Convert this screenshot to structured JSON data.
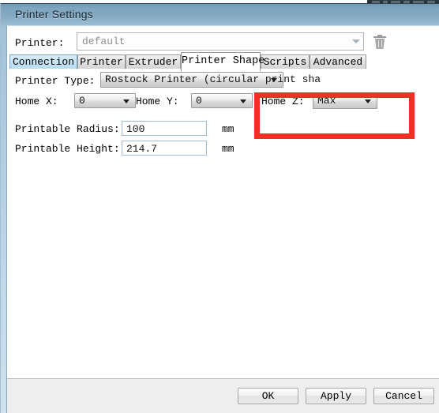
{
  "window": {
    "title": "Printer Settings"
  },
  "printer_row": {
    "label": "Printer:",
    "value": "default",
    "delete_icon": "trash-icon"
  },
  "tabs": [
    {
      "label": "Connection",
      "state": "hover"
    },
    {
      "label": "Printer",
      "state": "normal"
    },
    {
      "label": "Extruder",
      "state": "normal"
    },
    {
      "label": "Printer Shape",
      "state": "active"
    },
    {
      "label": "Scripts",
      "state": "normal"
    },
    {
      "label": "Advanced",
      "state": "normal"
    }
  ],
  "form": {
    "printer_type": {
      "label": "Printer Type:",
      "value": "Rostock Printer (circular print sha"
    },
    "home_x": {
      "label": "Home X:",
      "value": "0"
    },
    "home_y": {
      "label": "Home Y:",
      "value": "0"
    },
    "home_z": {
      "label": "Home Z:",
      "value": "Max"
    },
    "printable_radius": {
      "label": "Printable Radius:",
      "value": "100",
      "unit": "mm"
    },
    "printable_height": {
      "label": "Printable Height:",
      "value": "214.7",
      "unit": "mm"
    }
  },
  "annotation": {
    "color": "#ef3124",
    "target": "home-z-field"
  },
  "footer": {
    "ok": "OK",
    "apply": "Apply",
    "cancel": "Cancel"
  }
}
